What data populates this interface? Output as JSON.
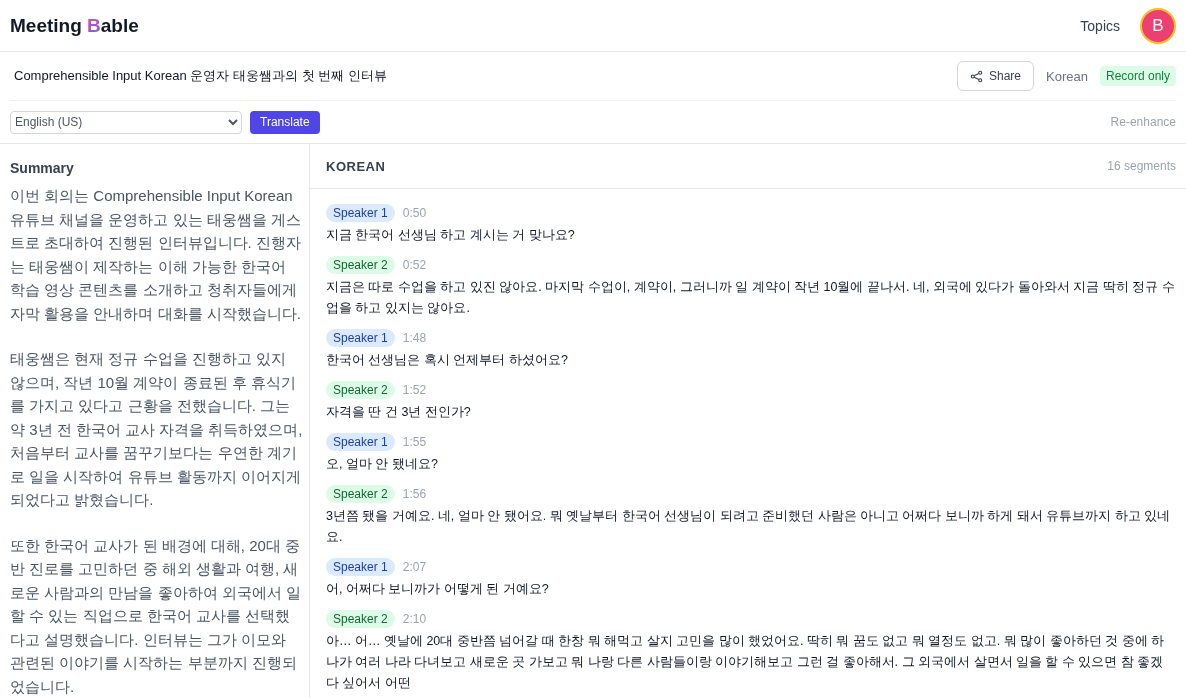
{
  "header": {
    "logo": {
      "before": "Meeting ",
      "mark": "B",
      "after": "able"
    },
    "nav": "Topics",
    "avatar": "B"
  },
  "meeting": {
    "title": "Comprehensible Input Korean 운영자 태웅쌤과의 첫 번째 인터뷰",
    "share": "Share",
    "language": "Korean",
    "badge": "Record only"
  },
  "toolbar": {
    "language_select": "English (US)",
    "translate": "Translate",
    "reenhance": "Re-enhance"
  },
  "summary": {
    "heading": "Summary",
    "paragraphs": [
      "이번 회의는 Comprehensible Input Korean 유튜브 채널을 운영하고 있는 태웅쌤을 게스트로 초대하여 진행된 인터뷰입니다. 진행자는 태웅쌤이 제작하는 이해 가능한 한국어 학습 영상 콘텐츠를 소개하고 청취자들에게 자막 활용을 안내하며 대화를 시작했습니다.",
      "태웅쌤은 현재 정규 수업을 진행하고 있지 않으며, 작년 10월 계약이 종료된 후 휴식기를 가지고 있다고 근황을 전했습니다. 그는 약 3년 전 한국어 교사 자격을 취득하였으며, 처음부터 교사를 꿈꾸기보다는 우연한 계기로 일을 시작하여 유튜브 활동까지 이어지게 되었다고 밝혔습니다.",
      "또한 한국어 교사가 된 배경에 대해, 20대 중반 진로를 고민하던 중 해외 생활과 여행, 새로운 사람과의 만남을 좋아하여 외국에서 일할 수 있는 직업으로 한국어 교사를 선택했다고 설명했습니다. 인터뷰는 그가 이모와 관련된 이야기를 시작하는 부분까지 진행되었습니다."
    ]
  },
  "transcript": {
    "heading": "KOREAN",
    "count": "16 segments",
    "segments": [
      {
        "speaker": "Speaker 1",
        "color": "#dbeafe",
        "time": "0:50",
        "text": "지금 한국어 선생님 하고 계시는 거 맞나요?"
      },
      {
        "speaker": "Speaker 2",
        "color": "#dcfce7",
        "time": "0:52",
        "text": "지금은 따로 수업을 하고 있진 않아요. 마지막 수업이, 계약이, 그러니까 일 계약이 작년 10월에 끝나서. 네, 외국에 있다가 돌아와서 지금 딱히 정규 수업을 하고 있지는 않아요."
      },
      {
        "speaker": "Speaker 1",
        "color": "#dbeafe",
        "time": "1:48",
        "text": "한국어 선생님은 혹시 언제부터 하셨어요?"
      },
      {
        "speaker": "Speaker 2",
        "color": "#dcfce7",
        "time": "1:52",
        "text": "자격을 딴 건 3년 전인가?"
      },
      {
        "speaker": "Speaker 1",
        "color": "#dbeafe",
        "time": "1:55",
        "text": "오, 얼마 안 됐네요?"
      },
      {
        "speaker": "Speaker 2",
        "color": "#dcfce7",
        "time": "1:56",
        "text": "3년쯤 됐을 거예요. 네, 얼마 안 됐어요. 뭐 옛날부터 한국어 선생님이 되려고 준비했던 사람은 아니고 어쩌다 보니까 하게 돼서 유튜브까지 하고 있네요."
      },
      {
        "speaker": "Speaker 1",
        "color": "#dbeafe",
        "time": "2:07",
        "text": "어, 어쩌다 보니까가 어떻게 된 거예요?"
      },
      {
        "speaker": "Speaker 2",
        "color": "#dcfce7",
        "time": "2:10",
        "text": "아… 어… 옛날에 20대 중반쯤 넘어갈 때 한창 뭐 해먹고 살지 고민을 많이 했었어요. 딱히 뭐 꿈도 없고 뭐 열정도 없고. 뭐 많이 좋아하던 것 중에 하나가 여러 나라 다녀보고 새로운 곳 가보고 뭐 나랑 다른 사람들이랑 이야기해보고 그런 걸 좋아해서. 그 외국에서 살면서 일을 할 수 있으면 참 좋겠다 싶어서 어떤"
      }
    ]
  }
}
